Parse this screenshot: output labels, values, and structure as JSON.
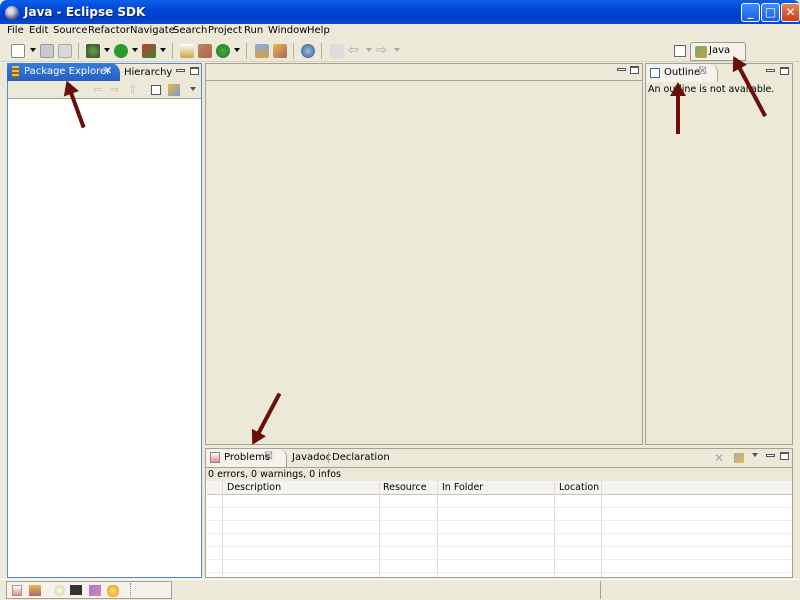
{
  "window": {
    "title": "Java - Eclipse SDK"
  },
  "menu": [
    "File",
    "Edit",
    "Source",
    "Refactor",
    "Navigate",
    "Search",
    "Project",
    "Run",
    "Window",
    "Help"
  ],
  "perspective": {
    "label": "Java"
  },
  "package_explorer": {
    "tab_label": "Package Explorer",
    "close_glyph": "✕",
    "second_tab": "Hierarchy"
  },
  "outline": {
    "tab_label": "Outline",
    "close_glyph": "☒",
    "message": "An outline is not available."
  },
  "problems": {
    "tabs": [
      "Problems",
      "Javadoc",
      "Declaration"
    ],
    "close_glyph": "☒",
    "summary": "0 errors, 0 warnings, 0 infos",
    "columns": [
      "Description",
      "Resource",
      "In Folder",
      "Location"
    ]
  },
  "colors": {
    "title_bar": "#0046d5",
    "active_tab": "#2460c8",
    "annotation_arrow": "#6b0f0a"
  }
}
